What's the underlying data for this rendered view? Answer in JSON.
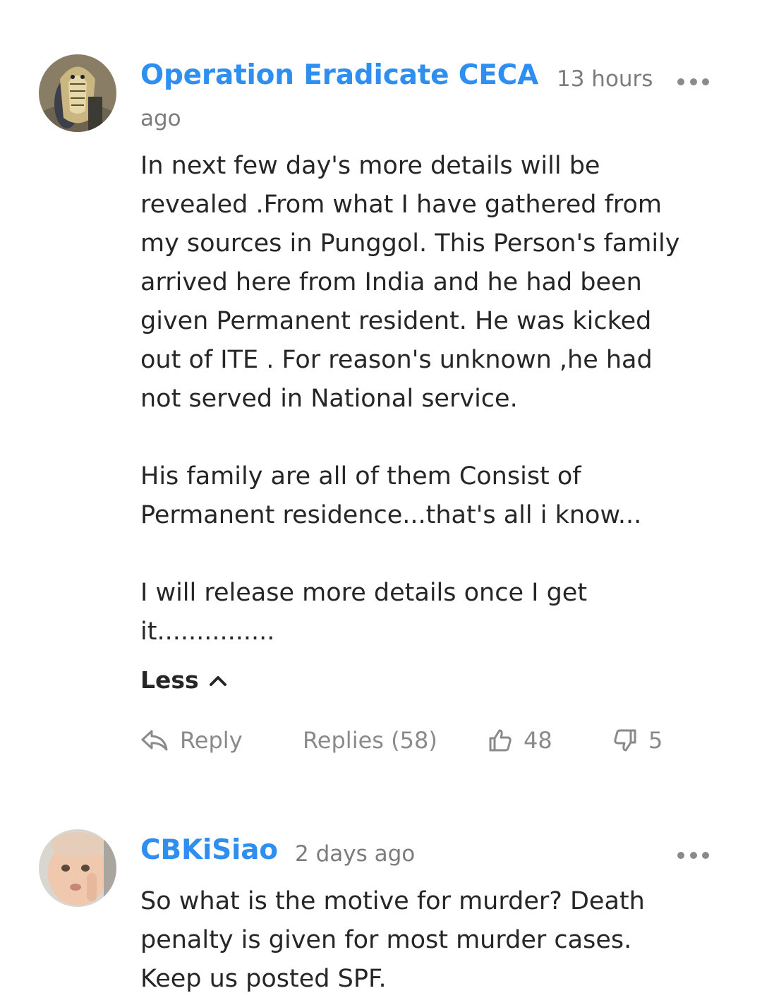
{
  "comments": [
    {
      "author": "Operation Eradicate CECA",
      "time_line1": "13 hours",
      "time_line2": "ago",
      "paragraphs": [
        [
          "In next few day's more details will be",
          "revealed .From what I have gathered from",
          "my sources in Punggol. This Person's family",
          "arrived here from India and he had been",
          "given Permanent resident. He was kicked",
          "out of ITE . For reason's unknown ,he had",
          "not served in National service."
        ],
        [
          "His family are all of them Consist of",
          "Permanent residence...that's all i know..."
        ],
        [
          "I will release more details once I get",
          "it..............."
        ]
      ],
      "less_label": "Less",
      "reply_label": "Reply",
      "replies_label": "Replies (58)",
      "likes": "48",
      "dislikes": "5"
    },
    {
      "author": "CBKiSiao",
      "time": "2 days ago",
      "paragraphs": [
        [
          "So what is the motive for murder? Death",
          "penalty is given for most murder cases.",
          "Keep us posted SPF."
        ]
      ]
    }
  ],
  "icons": {
    "more": "more-options-icon",
    "reply": "reply-arrow-icon",
    "like": "thumbs-up-icon",
    "dislike": "thumbs-down-icon",
    "chevron": "chevron-up-icon"
  },
  "colors": {
    "author": "#2e8ff0",
    "meta": "#7c7c7c",
    "text": "#262626"
  }
}
